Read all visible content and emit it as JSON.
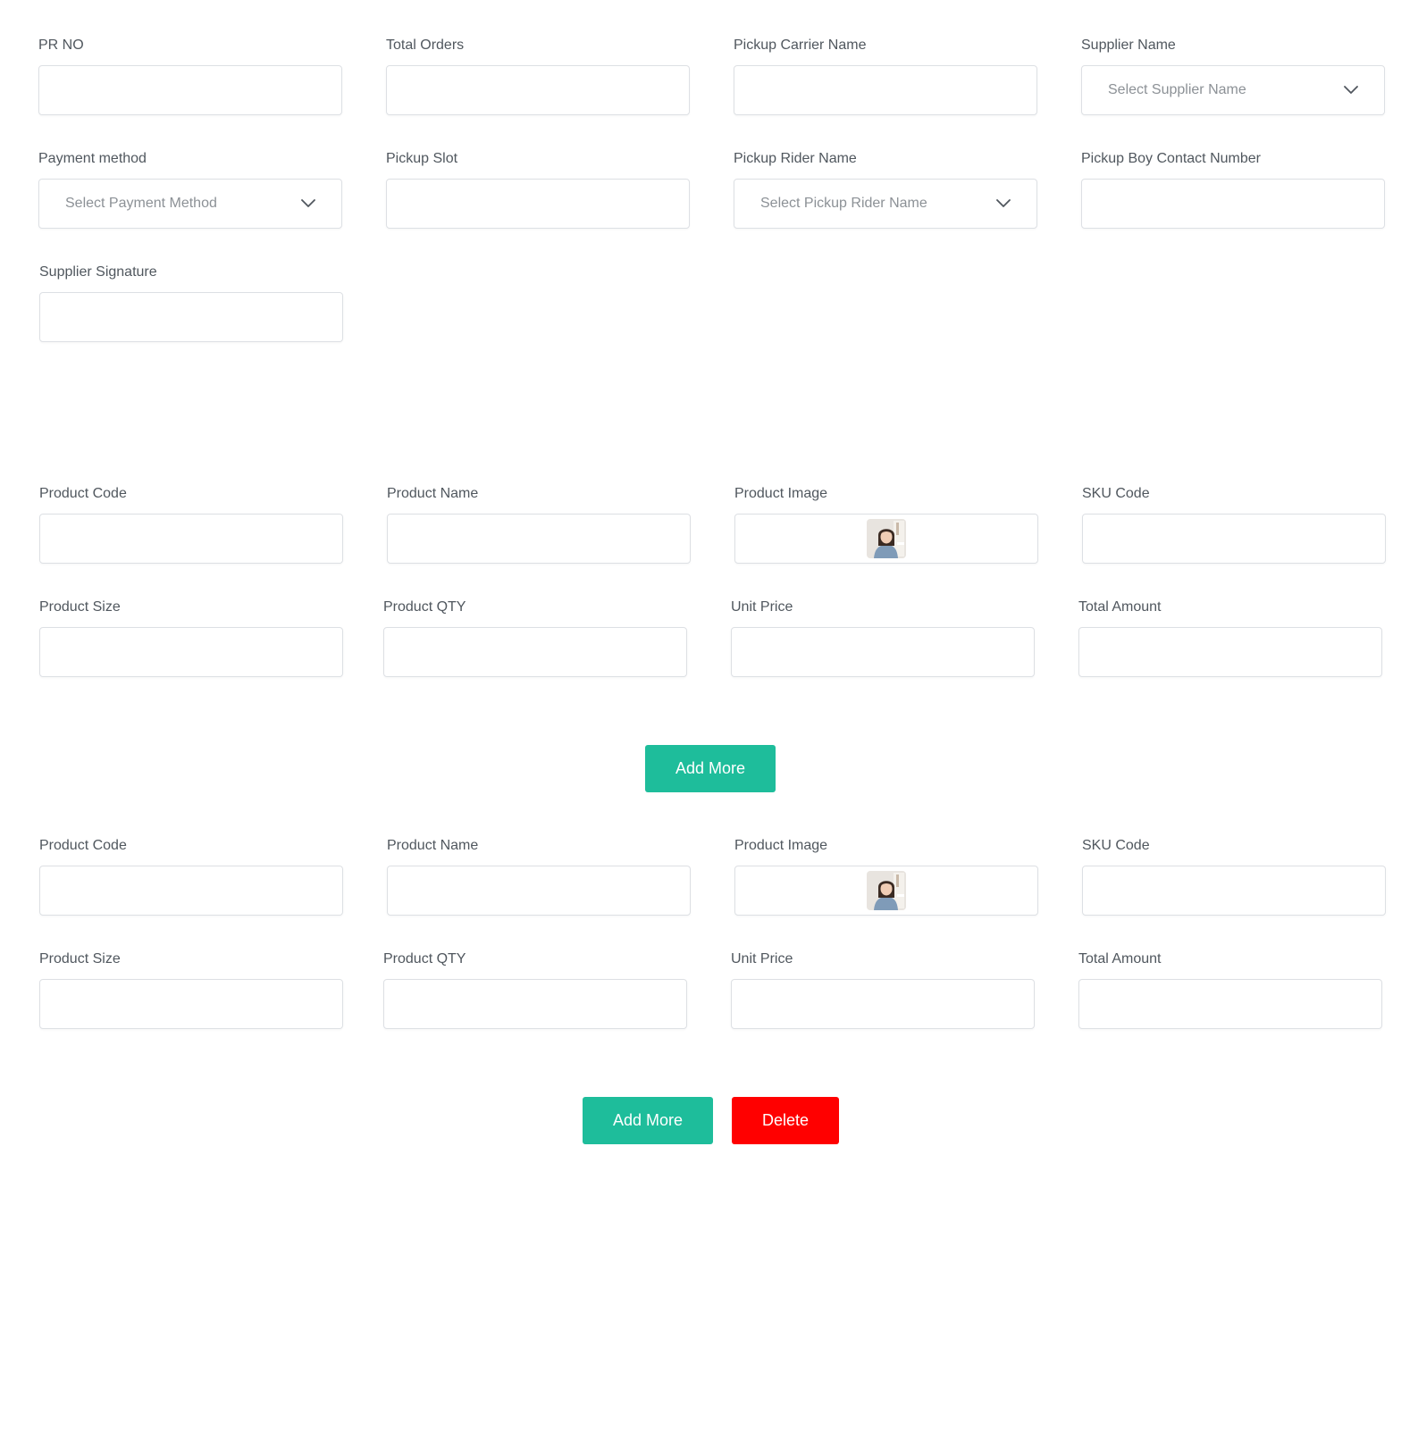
{
  "pickup_section": {
    "pr_no": {
      "label": "PR NO",
      "value": ""
    },
    "total_orders": {
      "label": "Total Orders",
      "value": ""
    },
    "pickup_carrier_name": {
      "label": "Pickup Carrier Name",
      "value": ""
    },
    "supplier_name": {
      "label": "Supplier Name",
      "placeholder": "Select Supplier Name"
    },
    "payment_method": {
      "label": "Payment method",
      "placeholder": "Select Payment Method"
    },
    "pickup_slot": {
      "label": "Pickup Slot",
      "value": ""
    },
    "pickup_rider_name": {
      "label": "Pickup Rider Name",
      "placeholder": "Select Pickup Rider Name"
    },
    "pickup_boy_contact": {
      "label": "Pickup Boy Contact Number",
      "value": ""
    },
    "supplier_signature": {
      "label": "Supplier Signature",
      "value": ""
    }
  },
  "product_rows": [
    {
      "product_code": {
        "label": "Product Code",
        "value": ""
      },
      "product_name": {
        "label": "Product Name",
        "value": ""
      },
      "product_image": {
        "label": "Product Image",
        "icon": "product-photo-thumbnail"
      },
      "sku_code": {
        "label": "SKU Code",
        "value": ""
      },
      "product_size": {
        "label": "Product Size",
        "value": ""
      },
      "product_qty": {
        "label": "Product QTY",
        "value": ""
      },
      "unit_price": {
        "label": "Unit Price",
        "value": ""
      },
      "total_amount": {
        "label": "Total Amount",
        "value": ""
      },
      "add_more_label": "Add More"
    },
    {
      "product_code": {
        "label": "Product Code",
        "value": ""
      },
      "product_name": {
        "label": "Product Name",
        "value": ""
      },
      "product_image": {
        "label": "Product Image",
        "icon": "product-photo-thumbnail"
      },
      "sku_code": {
        "label": "SKU Code",
        "value": ""
      },
      "product_size": {
        "label": "Product Size",
        "value": ""
      },
      "product_qty": {
        "label": "Product QTY",
        "value": ""
      },
      "unit_price": {
        "label": "Unit Price",
        "value": ""
      },
      "total_amount": {
        "label": "Total Amount",
        "value": ""
      },
      "add_more_label": "Add More",
      "delete_label": "Delete"
    }
  ],
  "colors": {
    "add_more_button": "#1ebd9b",
    "delete_button": "#ff0000",
    "label_text": "#50575e",
    "placeholder_text": "#8c9196",
    "input_border": "#dde0e4"
  },
  "icons": {
    "dropdown": "chevron-down-icon"
  }
}
